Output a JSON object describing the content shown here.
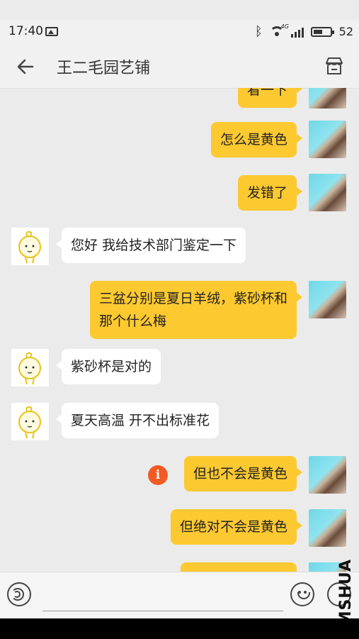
{
  "status_bar": {
    "time": "17:40",
    "network": "4G",
    "battery": "52"
  },
  "header": {
    "title": "王二毛园艺铺"
  },
  "messages": [
    {
      "from": "me",
      "text": "看一下"
    },
    {
      "from": "me",
      "text": "怎么是黄色"
    },
    {
      "from": "me",
      "text": "发错了"
    },
    {
      "from": "other",
      "text": "您好  我给技术部门鉴定一下"
    },
    {
      "from": "me",
      "text": "三盆分别是夏日羊绒，紫砂杯和\n那个什么梅"
    },
    {
      "from": "other",
      "text": "紫砂杯是对的"
    },
    {
      "from": "other",
      "text": "夏天高温 开不出标准花"
    },
    {
      "from": "me",
      "text": "但也不会是黄色",
      "status": "failed"
    },
    {
      "from": "me",
      "text": "但绝对不会是黄色"
    },
    {
      "from": "me",
      "text": ""
    }
  ],
  "input": {
    "placeholder": ""
  },
  "watermark": "MSHUA",
  "colors": {
    "bubble_me": "#fdc931",
    "bubble_other": "#ffffff",
    "background": "#ebebeb",
    "error": "#f15a22"
  }
}
